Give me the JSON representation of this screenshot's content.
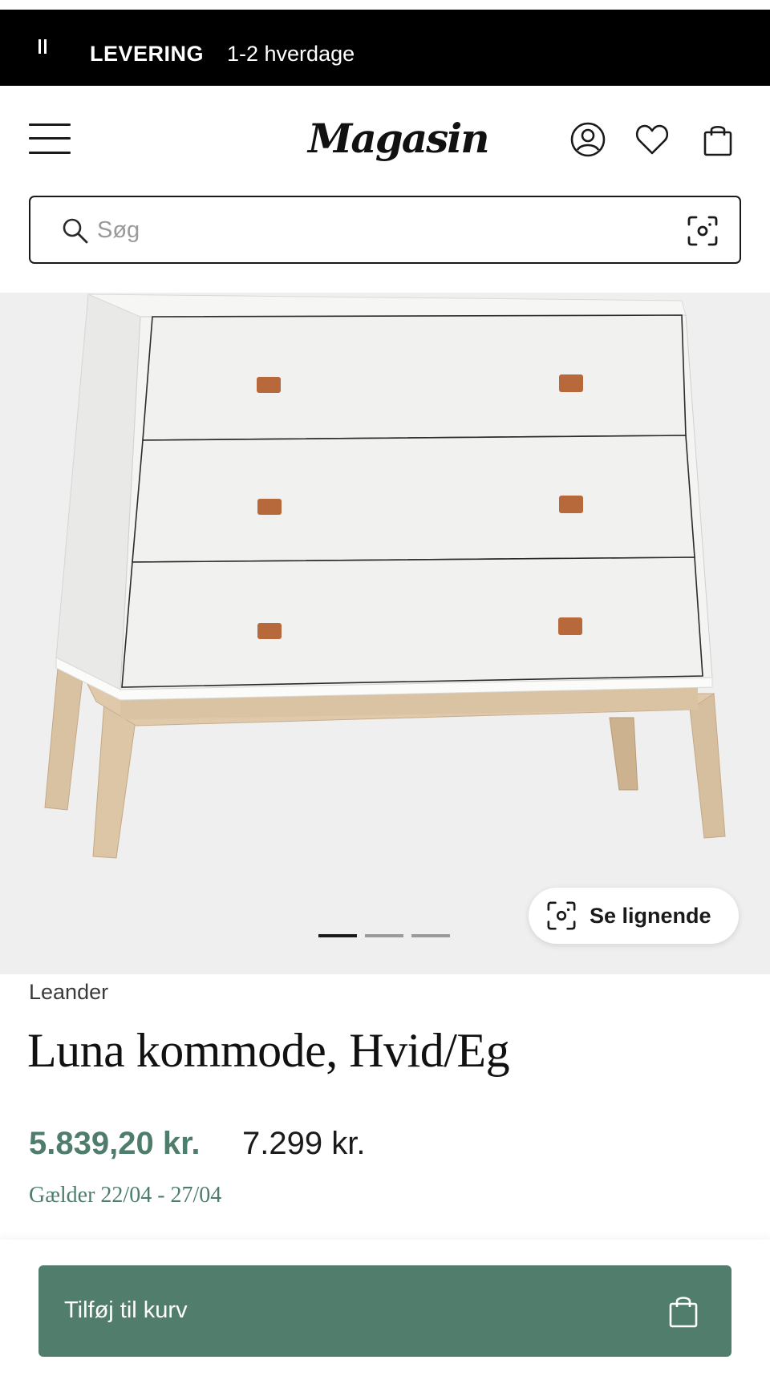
{
  "promo": {
    "label": "LEVERING",
    "value": "1-2 hverdage"
  },
  "header": {
    "logo": "Magasin",
    "icons": [
      "menu-icon",
      "account-icon",
      "heart-icon",
      "bag-icon"
    ]
  },
  "search": {
    "placeholder": "Søg",
    "value": ""
  },
  "gallery": {
    "slide_count": 3,
    "active_slide": 1,
    "similar_button": "Se lignende"
  },
  "product": {
    "brand": "Leander",
    "title": "Luna kommode, Hvid/Eg",
    "sale_price": "5.839,20 kr.",
    "original_price": "7.299 kr.",
    "validity": "Gælder 22/04 - 27/04"
  },
  "cart": {
    "label": "Tilføj til kurv"
  },
  "colors": {
    "accent_green": "#517d6d",
    "sale_price": "#4e7d6c",
    "promo_bg": "#000000",
    "gallery_bg": "#efefef"
  }
}
